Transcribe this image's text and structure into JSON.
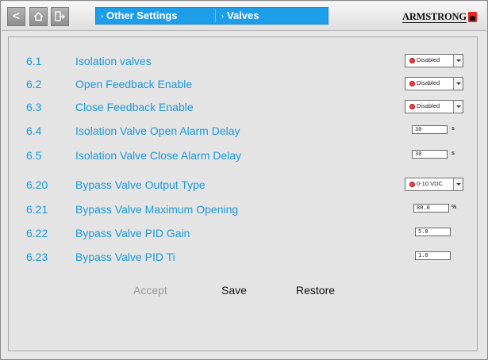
{
  "header": {
    "back_glyph": "<",
    "breadcrumb": [
      "Other Settings",
      "Valves"
    ],
    "crumb_separator": "›",
    "logo": "ARMSTRONG",
    "accent_color": "#1e9ee8"
  },
  "rows": [
    {
      "num": "6.1",
      "label": "Isolation valves",
      "control": "select",
      "value": "Disabled"
    },
    {
      "num": "6.2",
      "label": "Open Feedback Enable",
      "control": "select",
      "value": "Disabled"
    },
    {
      "num": "6.3",
      "label": "Close Feedback Enable",
      "control": "select",
      "value": "Disabled"
    },
    {
      "num": "6.4",
      "label": "Isolation Valve Open Alarm Delay",
      "control": "number",
      "value": "30",
      "unit": "s"
    },
    {
      "num": "6.5",
      "label": "Isolation Valve Close Alarm Delay",
      "control": "number",
      "value": "30",
      "unit": "s"
    },
    {
      "num": "6.20",
      "label": "Bypass Valve Output Type",
      "control": "select",
      "value": "0-10 VDC"
    },
    {
      "num": "6.21",
      "label": "Bypass Valve Maximum Opening",
      "control": "number",
      "value": "80.0",
      "unit": "%"
    },
    {
      "num": "6.22",
      "label": "Bypass Valve PID Gain",
      "control": "number",
      "value": "5.0",
      "unit": ""
    },
    {
      "num": "6.23",
      "label": "Bypass Valve PID Ti",
      "control": "number",
      "value": "1.0",
      "unit": ""
    }
  ],
  "actions": {
    "accept": "Accept",
    "save": "Save",
    "restore": "Restore"
  },
  "colors": {
    "label_blue": "#1c9ad7",
    "accept_disabled": "#9a9a9a",
    "status_dot": "#e44444"
  }
}
